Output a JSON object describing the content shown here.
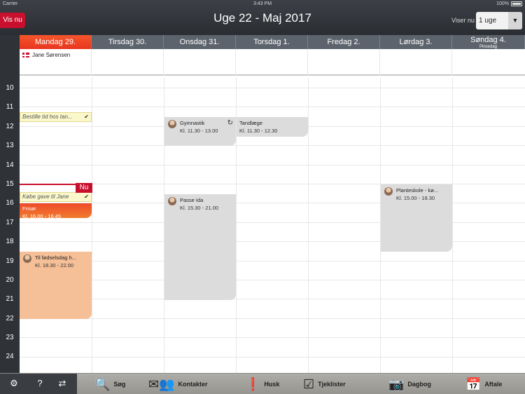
{
  "status": {
    "carrier": "Carrier",
    "time": "3:43 PM",
    "battery": "100%"
  },
  "header": {
    "now_button": "Vis nu",
    "title": "Uge 22 - Maj 2017",
    "viser_label": "Viser nu",
    "viser_value": "1 uge"
  },
  "days": [
    {
      "label": "Mandag 29.",
      "today": true
    },
    {
      "label": "Tirsdag 30."
    },
    {
      "label": "Onsdag 31."
    },
    {
      "label": "Torsdag 1."
    },
    {
      "label": "Fredag 2."
    },
    {
      "label": "Lørdag 3."
    },
    {
      "label": "Søndag 4.",
      "sub": "Pinsedag"
    }
  ],
  "person": {
    "name": "Jane Sørensen"
  },
  "hours": [
    "10",
    "11",
    "12",
    "13",
    "14",
    "15",
    "16",
    "17",
    "18",
    "19",
    "20",
    "21",
    "22",
    "23",
    "24"
  ],
  "now_badge": "Nu",
  "tasks": [
    {
      "title": "Bestille tid hos tan...",
      "day": 0
    },
    {
      "title": "Købe gave til Jane",
      "day": 0
    }
  ],
  "events": [
    {
      "title": "Gymnastik",
      "time": "Kl. 11.30 - 13.00",
      "day": 2
    },
    {
      "title": "Tandlæge",
      "time": "Kl. 11.30 - 12.30",
      "day": 3
    },
    {
      "title": "Passe Ida",
      "time": "Kl. 15.30 - 21.00",
      "day": 2
    },
    {
      "title": "Planteskole - kø...",
      "time": "Kl. 15.00 - 18.30",
      "day": 5
    },
    {
      "title": "Frisør",
      "time": "Kl. 16.00 - 16.45",
      "day": 0
    },
    {
      "title": "Til fødselsdag h...",
      "time": "Kl. 18.30 - 22.00",
      "day": 0
    }
  ],
  "colors": {
    "today": "#e8361f",
    "accent": "#c8102e",
    "event_grey": "#dcdcdc",
    "event_peach": "#f5bf97",
    "task": "#fbf8cc"
  },
  "toolbar": {
    "items": [
      {
        "label": "Søg",
        "icon": "search-icon"
      },
      {
        "label": "Kontakter",
        "icon": "contacts-icon"
      },
      {
        "label": "Husk",
        "icon": "reminder-icon"
      },
      {
        "label": "Tjeklister",
        "icon": "checklist-icon"
      },
      {
        "label": "Dagbog",
        "icon": "camera-diary-icon"
      },
      {
        "label": "Aftale",
        "icon": "calendar-appointment-icon"
      }
    ]
  }
}
